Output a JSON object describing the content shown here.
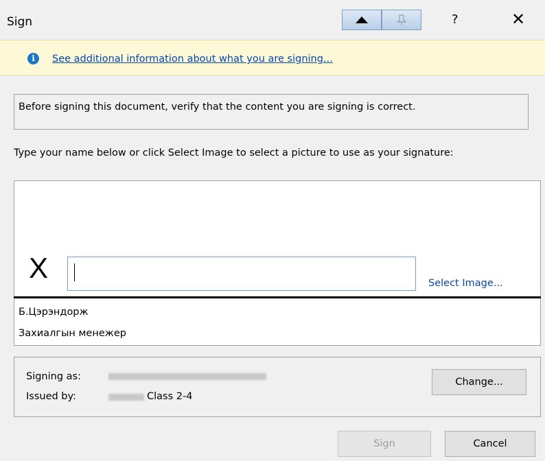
{
  "window": {
    "title": "Sign",
    "help_label": "?",
    "close_label": "✕"
  },
  "infobar": {
    "icon": "info-icon",
    "link_text": "See additional information about what you are signing..."
  },
  "verify_text": "Before signing this document, verify that the content you are signing is correct.",
  "instructions": "Type your name below or click Select Image to select a picture to use as your signature:",
  "signature": {
    "x_label": "X",
    "name_value": "",
    "select_image_label": "Select Image...",
    "signer_name": "Б.Цэрэндорж",
    "signer_title": "Захиалгын менежер"
  },
  "certificate": {
    "signing_as_label": "Signing as:",
    "issued_by_label": "Issued by:",
    "issued_by_suffix": "Class 2-4",
    "change_label": "Change..."
  },
  "buttons": {
    "sign_label": "Sign",
    "cancel_label": "Cancel"
  }
}
